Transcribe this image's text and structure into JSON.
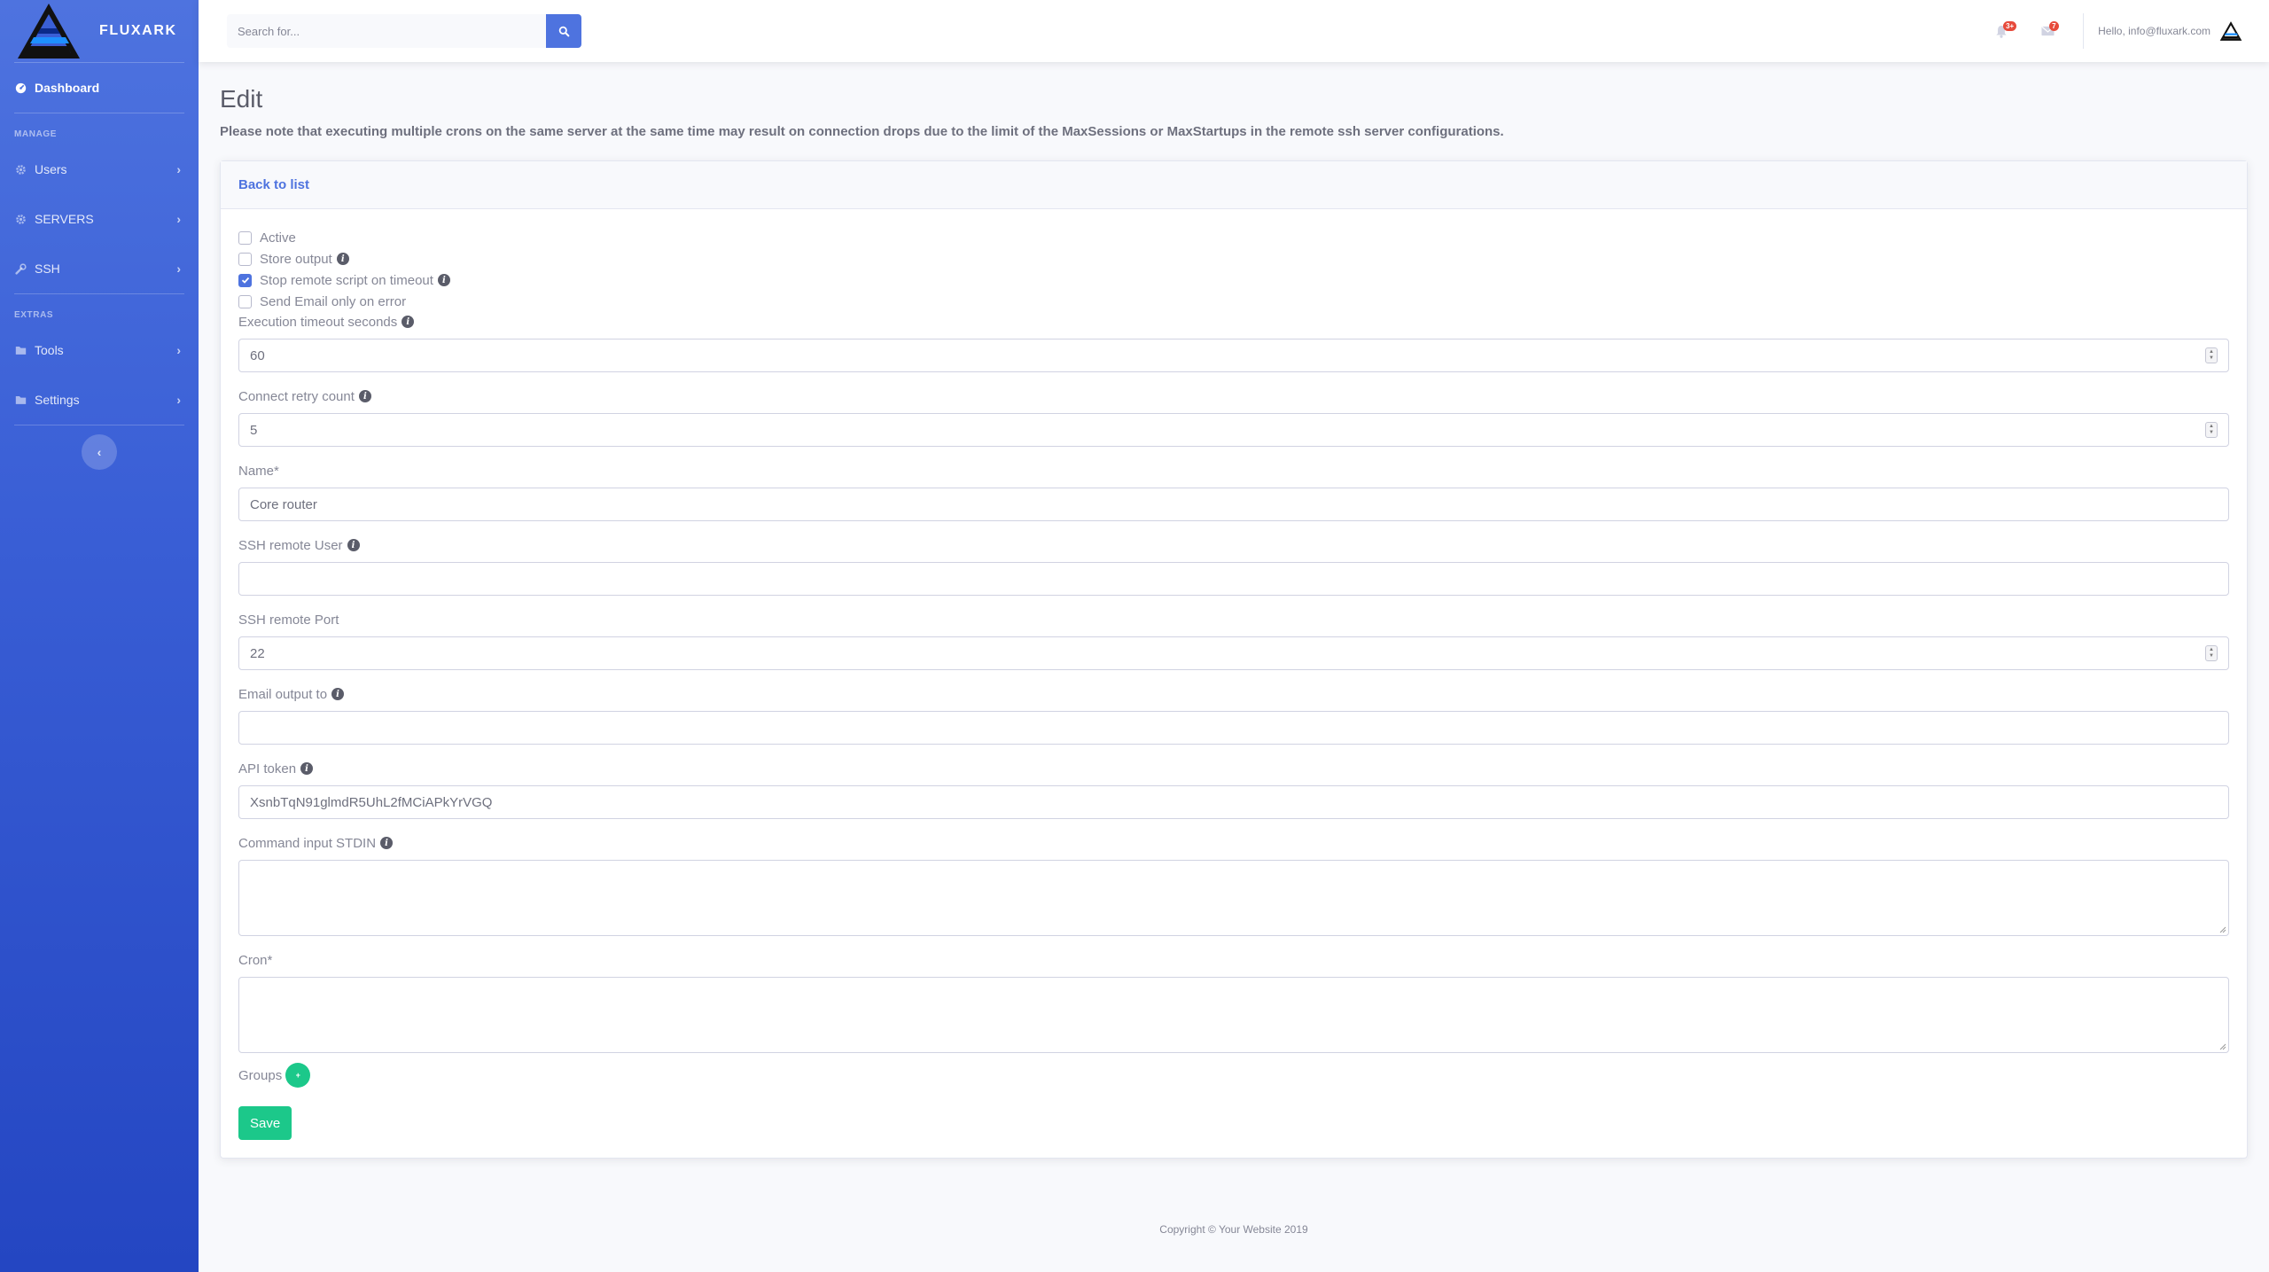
{
  "brand": {
    "name": "FLUXARK"
  },
  "sidebar": {
    "dashboard": "Dashboard",
    "heading_manage": "MANAGE",
    "heading_extras": "EXTRAS",
    "items": [
      {
        "label": "Users",
        "icon": "cog-icon"
      },
      {
        "label": "SERVERS",
        "icon": "cog-icon"
      },
      {
        "label": "SSH",
        "icon": "wrench-icon"
      },
      {
        "label": "Tools",
        "icon": "folder-icon"
      },
      {
        "label": "Settings",
        "icon": "folder-icon"
      }
    ],
    "toggle_icon": "chevron-left-icon"
  },
  "topbar": {
    "search_placeholder": "Search for...",
    "alerts_badge": "3+",
    "messages_badge": "7",
    "user_greeting": "Hello, info@fluxark.com"
  },
  "page": {
    "title": "Edit",
    "note": "Please note that executing multiple crons on the same server at the same time may result on connection drops due to the limit of the MaxSessions or MaxStartups in the remote ssh server configurations.",
    "back_link": "Back to list"
  },
  "form": {
    "checkboxes": [
      {
        "label": "Active",
        "checked": false,
        "info": false
      },
      {
        "label": "Store output",
        "checked": false,
        "info": true
      },
      {
        "label": "Stop remote script on timeout",
        "checked": true,
        "info": true
      },
      {
        "label": "Send Email only on error",
        "checked": false,
        "info": false
      }
    ],
    "execution_timeout": {
      "label": "Execution timeout seconds",
      "value": "60"
    },
    "retry_count": {
      "label": "Connect retry count",
      "value": "5"
    },
    "name": {
      "label": "Name*",
      "value": "Core router"
    },
    "ssh_user": {
      "label": "SSH remote User",
      "value": ""
    },
    "ssh_port": {
      "label": "SSH remote Port",
      "value": "22"
    },
    "email_output": {
      "label": "Email output to",
      "value": ""
    },
    "api_token": {
      "label": "API token",
      "value": "XsnbTqN91glmdR5UhL2fMCiAPkYrVGQ"
    },
    "stdin": {
      "label": "Command input STDIN",
      "value": ""
    },
    "cron": {
      "label": "Cron*",
      "value": ""
    },
    "groups": {
      "label": "Groups",
      "add_symbol": "+"
    },
    "save": "Save"
  },
  "footer": {
    "copyright": "Copyright © Your Website 2019"
  },
  "colors": {
    "primary": "#4e73df",
    "success": "#1cc88a",
    "danger": "#e74a3b"
  }
}
